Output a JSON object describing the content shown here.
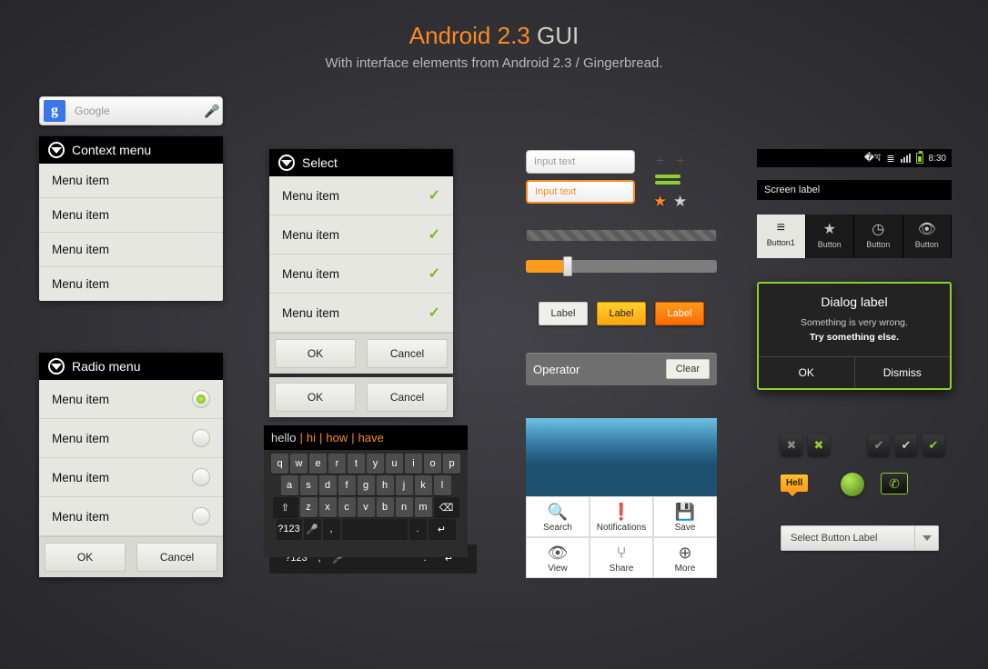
{
  "title": {
    "accent": "Android 2.3",
    "rest": "GUI"
  },
  "subtitle": "With interface elements from Android 2.3 / Gingerbread.",
  "search": {
    "placeholder": "Google"
  },
  "context_menu": {
    "title": "Context menu",
    "items": [
      "Menu item",
      "Menu item",
      "Menu item",
      "Menu item"
    ]
  },
  "radio_menu": {
    "title": "Radio menu",
    "items": [
      "Menu item",
      "Menu item",
      "Menu item",
      "Menu item"
    ],
    "ok": "OK",
    "cancel": "Cancel"
  },
  "select_menu": {
    "title": "Select",
    "items": [
      "Menu item",
      "Menu item",
      "Menu item",
      "Menu item"
    ],
    "ok": "OK",
    "cancel": "Cancel"
  },
  "standalone_row": {
    "ok": "OK",
    "cancel": "Cancel"
  },
  "kb_sugg": {
    "word": "hello",
    "alts": [
      "hi",
      "how",
      "have"
    ]
  },
  "kb_rows": {
    "r1": [
      "q",
      "w",
      "e",
      "r",
      "t",
      "y",
      "u",
      "i",
      "o",
      "p"
    ],
    "r2": [
      "a",
      "s",
      "d",
      "f",
      "g",
      "h",
      "j",
      "k",
      "l"
    ],
    "r3_mid": [
      "z",
      "x",
      "c",
      "v",
      "b",
      "n",
      "m"
    ],
    "sym": "?123"
  },
  "inputs": {
    "a": "Input text",
    "b": "Input text"
  },
  "labels": {
    "a": "Label",
    "b": "Label",
    "c": "Label"
  },
  "operator": {
    "name": "Operator",
    "clear": "Clear"
  },
  "appgrid": {
    "items": [
      {
        "icon": "search-icon",
        "glyph": "🔍",
        "label": "Search"
      },
      {
        "icon": "bell-icon",
        "glyph": "❗",
        "label": "Notifications"
      },
      {
        "icon": "save-icon",
        "glyph": "💾",
        "label": "Save"
      },
      {
        "icon": "eye-icon",
        "glyph": "👁",
        "label": "View"
      },
      {
        "icon": "share-icon",
        "glyph": "⑂",
        "label": "Share"
      },
      {
        "icon": "more-icon",
        "glyph": "⊕",
        "label": "More"
      }
    ]
  },
  "statusbar": {
    "time": "8:30"
  },
  "screen_label": "Screen label",
  "tabs": [
    {
      "label": "Button1",
      "glyph": "≡",
      "active": true
    },
    {
      "label": "Button",
      "glyph": "★",
      "active": false
    },
    {
      "label": "Button",
      "glyph": "◷",
      "active": false
    },
    {
      "label": "Button",
      "glyph": "👁",
      "active": false
    }
  ],
  "dialog": {
    "title": "Dialog label",
    "line1": "Something is very wrong.",
    "line2": "Try something else.",
    "ok": "OK",
    "dismiss": "Dismiss"
  },
  "toast": "Hell",
  "dropdown": "Select Button Label"
}
